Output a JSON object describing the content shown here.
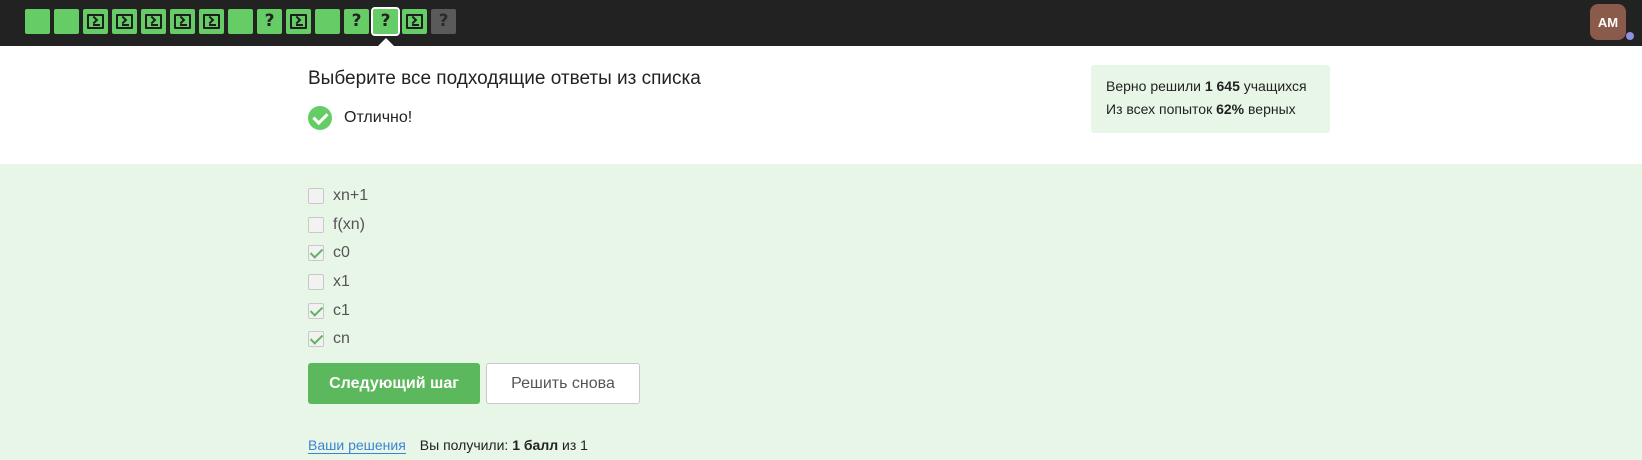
{
  "steps": [
    {
      "kind": "plain",
      "state": "done"
    },
    {
      "kind": "plain",
      "state": "done"
    },
    {
      "kind": "code",
      "state": "done"
    },
    {
      "kind": "code",
      "state": "done"
    },
    {
      "kind": "code",
      "state": "done"
    },
    {
      "kind": "code",
      "state": "done"
    },
    {
      "kind": "code",
      "state": "done"
    },
    {
      "kind": "plain",
      "state": "done"
    },
    {
      "kind": "quiz",
      "state": "done"
    },
    {
      "kind": "code",
      "state": "done"
    },
    {
      "kind": "plain",
      "state": "done"
    },
    {
      "kind": "quiz",
      "state": "done"
    },
    {
      "kind": "quiz",
      "state": "active"
    },
    {
      "kind": "code",
      "state": "done"
    },
    {
      "kind": "quiz",
      "state": "unsolved"
    }
  ],
  "step_glyph_quiz": "?",
  "user": {
    "initials": "AM"
  },
  "question": {
    "title": "Выберите все подходящие ответы из списка"
  },
  "feedback": {
    "text": "Отлично!"
  },
  "stats": {
    "line1_prefix": "Верно решили",
    "solved_count": "1 645",
    "line1_suffix": "учащихся",
    "line2_prefix": "Из всех попыток",
    "percent": "62%",
    "line2_suffix": "верных"
  },
  "options": [
    {
      "label": "xn+1",
      "checked": false
    },
    {
      "label": "f(xn)",
      "checked": false
    },
    {
      "label": "c0",
      "checked": true
    },
    {
      "label": "x1",
      "checked": false
    },
    {
      "label": "c1",
      "checked": true
    },
    {
      "label": "cn",
      "checked": true
    }
  ],
  "buttons": {
    "next": "Следующий шаг",
    "retry": "Решить снова"
  },
  "footer": {
    "solutions_link": "Ваши решения",
    "score_prefix": "Вы получили:",
    "score": "1 балл",
    "score_suffix": "из 1"
  },
  "colors": {
    "accent": "#66cc66",
    "button": "#5cb85c",
    "topbar": "#222222",
    "panel": "#e8f6e8"
  }
}
